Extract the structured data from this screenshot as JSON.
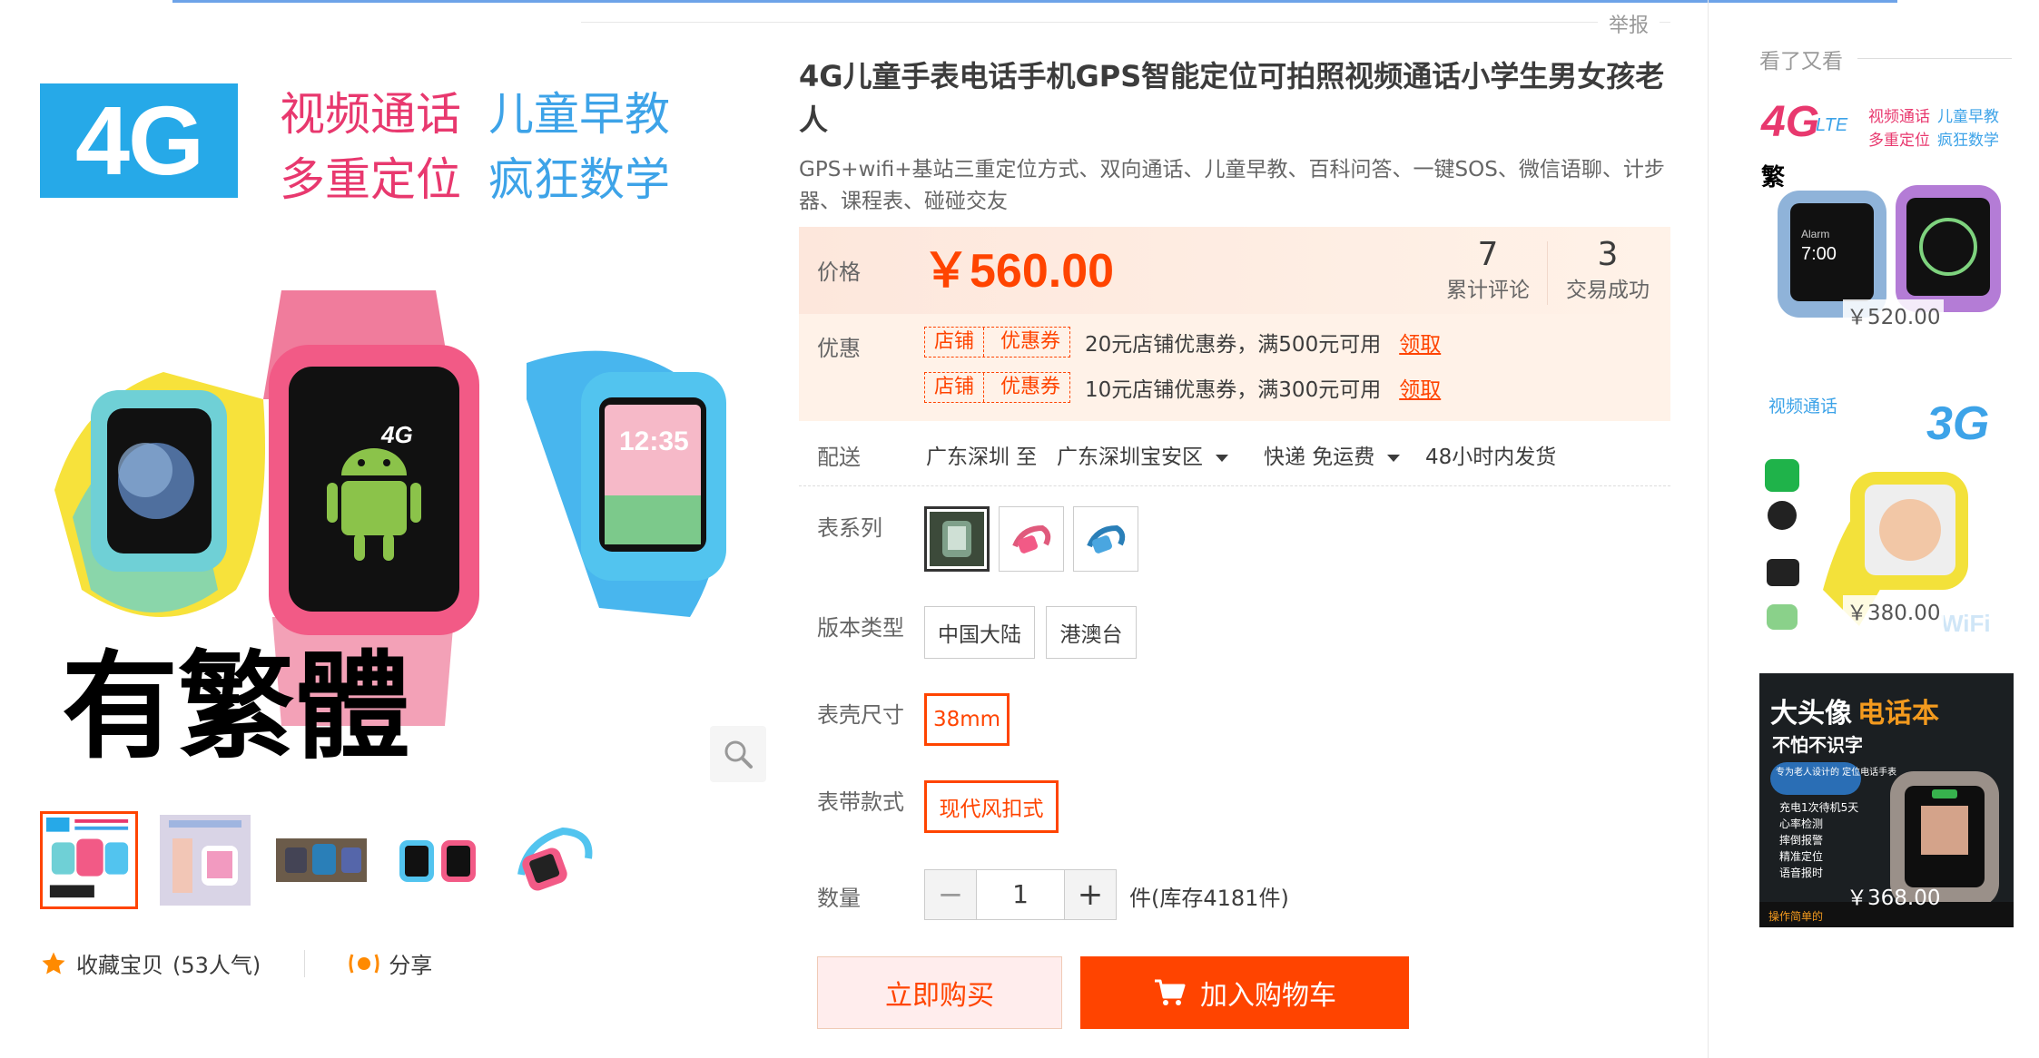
{
  "header": {
    "report_label": "举报"
  },
  "gallery": {
    "hero_badge": "4G",
    "hero_lines": [
      "视频通话",
      "儿童早教",
      "多重定位",
      "疯狂数学"
    ],
    "hero_trad_text": "有繁體",
    "hero_watch_lte": "4G",
    "hero_watch_time": "12:35",
    "thumb_count": 5,
    "selected_thumb": 0
  },
  "actions": {
    "favorite_label": "收藏宝贝",
    "favorite_count": "(53人气)",
    "share_label": "分享"
  },
  "product": {
    "title": "4G儿童手表电话手机GPS智能定位可拍照视频通话小学生男女孩老人",
    "subtitle": "GPS+wifi+基站三重定位方式、双向通话、儿童早教、百科问答、一键SOS、微信语聊、计步器、课程表、碰碰交友"
  },
  "pricing": {
    "price_label": "价格",
    "currency": "￥",
    "price": "560.00",
    "reviews_count": "7",
    "reviews_label": "累计评论",
    "deals_count": "3",
    "deals_label": "交易成功",
    "promo_label": "优惠",
    "coupon_tag_left": "店铺",
    "coupon_tag_right": "优惠券",
    "coupons": [
      {
        "text": "20元店铺优惠券，满500元可用",
        "link": "领取"
      },
      {
        "text": "10元店铺优惠券，满300元可用",
        "link": "领取"
      }
    ]
  },
  "shipping": {
    "label": "配送",
    "from": "广东深圳 至",
    "to": "广东深圳宝安区",
    "method": "快递 免运费",
    "dispatch": "48小时内发货"
  },
  "options": {
    "series_label": "表系列",
    "version_label": "版本类型",
    "version_values": [
      "中国大陆",
      "港澳台"
    ],
    "case_label": "表壳尺寸",
    "case_value": "38mm",
    "strap_label": "表带款式",
    "strap_value": "现代风扣式"
  },
  "quantity": {
    "label": "数量",
    "minus": "−",
    "value": "1",
    "plus": "+",
    "stock": "件(库存4181件)"
  },
  "buttons": {
    "buy_now": "立即购买",
    "add_to_cart": "加入购物车"
  },
  "sidebar": {
    "title": "看了又看",
    "items": [
      {
        "price": "￥520.00",
        "badge": "4G",
        "badge_suffix": "LTE",
        "lines": [
          "视频通话",
          "儿童早教",
          "多重定位",
          "疯狂数学"
        ],
        "note": "繁",
        "watch_time": "7:00",
        "watch_caption": "Alarm"
      },
      {
        "price": "￥380.00",
        "heading": "视频通话",
        "badge": "3G",
        "watermark": "WiFi"
      },
      {
        "price": "￥368.00",
        "heading_white": "大头像",
        "heading_orange": "电话本",
        "subheading": "不怕不识字",
        "pill": "专为老人设计的\n定位电话手表",
        "features": [
          "充电1次待机5天",
          "心率检测",
          "摔倒报警",
          "精准定位",
          "语音报时"
        ],
        "footer": "操作简单的"
      }
    ]
  },
  "colors": {
    "accent": "#ff4400",
    "price_bg": "#fff2e8",
    "blue": "#26a9e8",
    "pink": "#e8386e"
  }
}
